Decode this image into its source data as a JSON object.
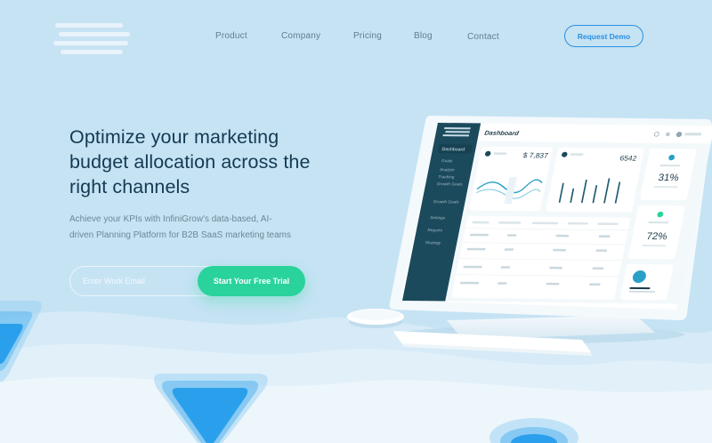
{
  "header": {
    "nav": [
      "Product",
      "Company",
      "Pricing",
      "Blog",
      "Contact"
    ],
    "cta": "Request Demo"
  },
  "hero": {
    "title_line1": "Optimize your marketing",
    "title_line2": "budget allocation across the",
    "title_line3": "right channels",
    "subtitle_line1": "Achieve your KPIs with InfiniGrow's data-based, AI-",
    "subtitle_line2": "driven Planning Platform for B2B SaaS marketing teams",
    "email_placeholder": "Enter Work Email",
    "cta": "Start Your Free Trial"
  },
  "dashboard": {
    "title": "Dashboard",
    "menu_active": "Dashboard",
    "menu": [
      "Dashboard",
      "Goals",
      "Analyze",
      "Tracking",
      "Growth Goals",
      "Growth Goals",
      "Settings",
      "Reports",
      "Strategy"
    ],
    "value_1": "$ 7,837",
    "value_2": "6542",
    "value_3": "31%",
    "value_4": "72%",
    "colors": {
      "sidebar": "#1b4a5c",
      "accent": "#2aa0c8",
      "bars": "#1f5a6e"
    }
  },
  "colors": {
    "background": "#c6e3f4",
    "brand": "#2a8fe0",
    "cta": "#2ad39c",
    "heading": "#143a52"
  }
}
